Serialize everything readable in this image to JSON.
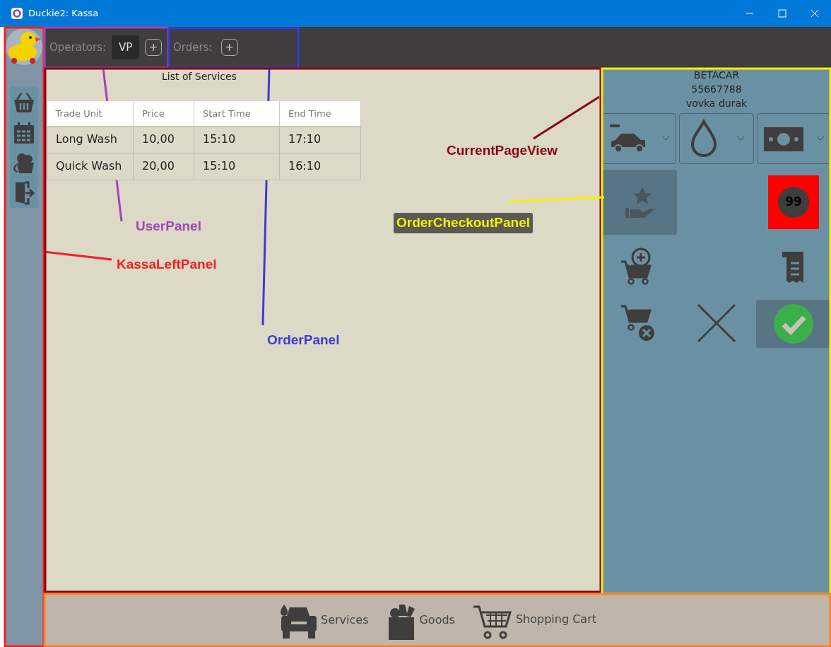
{
  "window": {
    "title": "Duckie2: Kassa"
  },
  "sidebar": {
    "items": [
      {
        "kind": "basket"
      },
      {
        "kind": "calendar"
      },
      {
        "kind": "bucket"
      },
      {
        "kind": "logout"
      }
    ]
  },
  "user_panel": {
    "label": "Operators:",
    "operators": [
      "VP"
    ],
    "add_button": "+"
  },
  "order_panel": {
    "label": "Orders:",
    "add_button": "+"
  },
  "services": {
    "title": "List of Services",
    "table": {
      "columns": [
        "Trade Unit",
        "Price",
        "Start Time",
        "End Time"
      ],
      "rows": [
        [
          "Long Wash",
          "10,00",
          "15:10",
          "17:10"
        ],
        [
          "Quick Wash",
          "20,00",
          "15:10",
          "16:10"
        ]
      ]
    }
  },
  "checkout": {
    "customer": [
      "BETACAR",
      "55667788",
      "vovka durak"
    ],
    "selectors": [
      {
        "kind": "car"
      },
      {
        "kind": "drop"
      },
      {
        "kind": "money"
      }
    ],
    "actions": [
      {
        "kind": "loyalty",
        "disabled": true
      },
      {
        "kind": "badge",
        "text": "99"
      },
      {
        "kind": "cart-add"
      },
      {
        "kind": "receipt"
      },
      {
        "kind": "cart-remove"
      },
      {
        "kind": "cancel"
      },
      {
        "kind": "confirm"
      }
    ]
  },
  "bottom_nav": [
    {
      "kind": "services",
      "label": "Services"
    },
    {
      "kind": "goods",
      "label": "Goods"
    },
    {
      "kind": "cart",
      "label": "Shopping Cart"
    }
  ],
  "annotations": [
    {
      "label": "KassaLeftPanel",
      "color": "#ee2222"
    },
    {
      "label": "UserPanel",
      "color": "#a545b5"
    },
    {
      "label": "OrderPanel",
      "color": "#3b3bd6"
    },
    {
      "label": "CurrentPageView",
      "color": "#8b0012"
    },
    {
      "label": "OrderCheckoutPanel",
      "color": "#f5f000"
    },
    {
      "color": "#ff7f27"
    }
  ]
}
